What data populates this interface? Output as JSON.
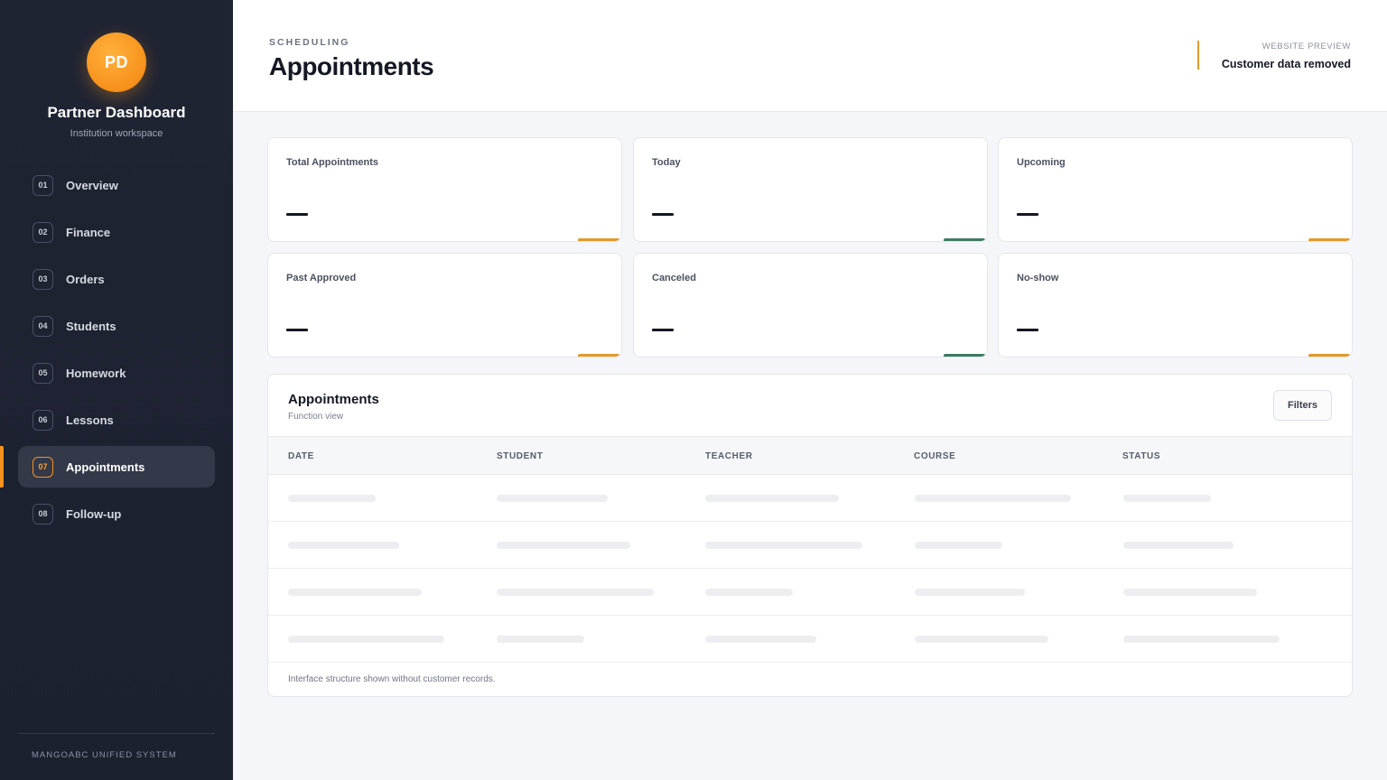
{
  "sidebar": {
    "avatar_initials": "PD",
    "title": "Partner Dashboard",
    "subtitle": "Institution workspace",
    "items": [
      {
        "num": "01",
        "label": "Overview"
      },
      {
        "num": "02",
        "label": "Finance"
      },
      {
        "num": "03",
        "label": "Orders"
      },
      {
        "num": "04",
        "label": "Students"
      },
      {
        "num": "05",
        "label": "Homework"
      },
      {
        "num": "06",
        "label": "Lessons"
      },
      {
        "num": "07",
        "label": "Appointments",
        "active": true
      },
      {
        "num": "08",
        "label": "Follow-up"
      }
    ],
    "footer": "MANGOABC UNIFIED SYSTEM"
  },
  "header": {
    "eyebrow": "SCHEDULING",
    "title": "Appointments",
    "preview_label": "WEBSITE PREVIEW",
    "preview_value": "Customer data removed"
  },
  "stats": [
    {
      "label": "Total Appointments",
      "accent": "#e39a2a"
    },
    {
      "label": "Today",
      "accent": "#3f7a63"
    },
    {
      "label": "Upcoming",
      "accent": "#e39a2a"
    },
    {
      "label": "Past Approved",
      "accent": "#e39a2a"
    },
    {
      "label": "Canceled",
      "accent": "#3f7a63"
    },
    {
      "label": "No-show",
      "accent": "#e39a2a"
    }
  ],
  "table": {
    "title": "Appointments",
    "subtitle": "Function view",
    "filters_label": "Filters",
    "columns": [
      "DATE",
      "STUDENT",
      "TEACHER",
      "COURSE",
      "STATUS"
    ],
    "footer": "Interface structure shown without customer records."
  },
  "colors": {
    "accent": "#f7931e",
    "sidebar_bg": "#1f2433",
    "accent_green": "#3f7a63"
  }
}
